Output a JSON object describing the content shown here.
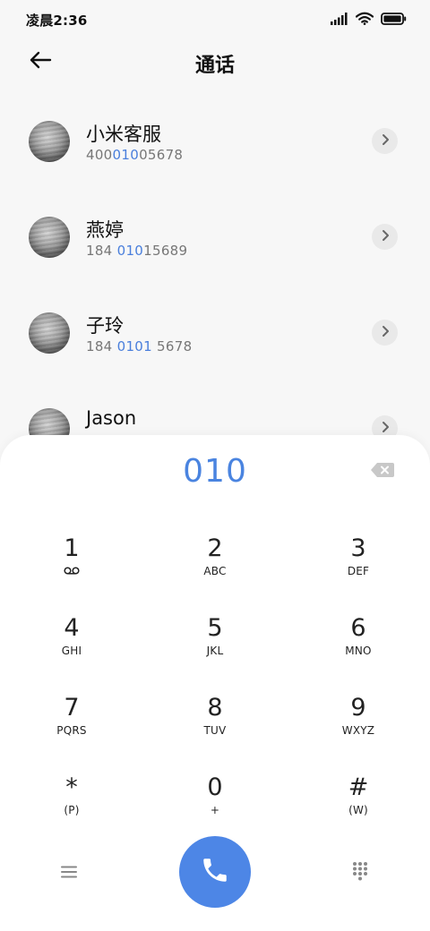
{
  "status_bar": {
    "time": "凌晨2:36",
    "signal_icon": "signal-bars-icon",
    "wifi_icon": "wifi-icon",
    "battery_icon": "battery-icon"
  },
  "header": {
    "title": "通话",
    "back_icon": "back-arrow-icon"
  },
  "contacts": [
    {
      "name": "小米客服",
      "number_pre": "400",
      "number_match": "010",
      "number_post": "05678"
    },
    {
      "name": "燕婷",
      "number_pre": "184 ",
      "number_match": "010",
      "number_post": "15689"
    },
    {
      "name": "子玲",
      "number_pre": "184 ",
      "number_match": "0101",
      "number_post": " 5678"
    },
    {
      "name": "Jason",
      "number_pre": "",
      "number_match": "",
      "number_post": ""
    }
  ],
  "dialer": {
    "input": "010",
    "highlight_color": "#4a84e0",
    "keys": [
      {
        "digit": "1",
        "sub": "",
        "icon": "voicemail-icon"
      },
      {
        "digit": "2",
        "sub": "ABC"
      },
      {
        "digit": "3",
        "sub": "DEF"
      },
      {
        "digit": "4",
        "sub": "GHI"
      },
      {
        "digit": "5",
        "sub": "JKL"
      },
      {
        "digit": "6",
        "sub": "MNO"
      },
      {
        "digit": "7",
        "sub": "PQRS"
      },
      {
        "digit": "8",
        "sub": "TUV"
      },
      {
        "digit": "9",
        "sub": "WXYZ"
      },
      {
        "digit": "*",
        "sub": "(P)"
      },
      {
        "digit": "0",
        "sub": "+"
      },
      {
        "digit": "#",
        "sub": "(W)"
      }
    ],
    "call_color": "#4d86e6"
  }
}
